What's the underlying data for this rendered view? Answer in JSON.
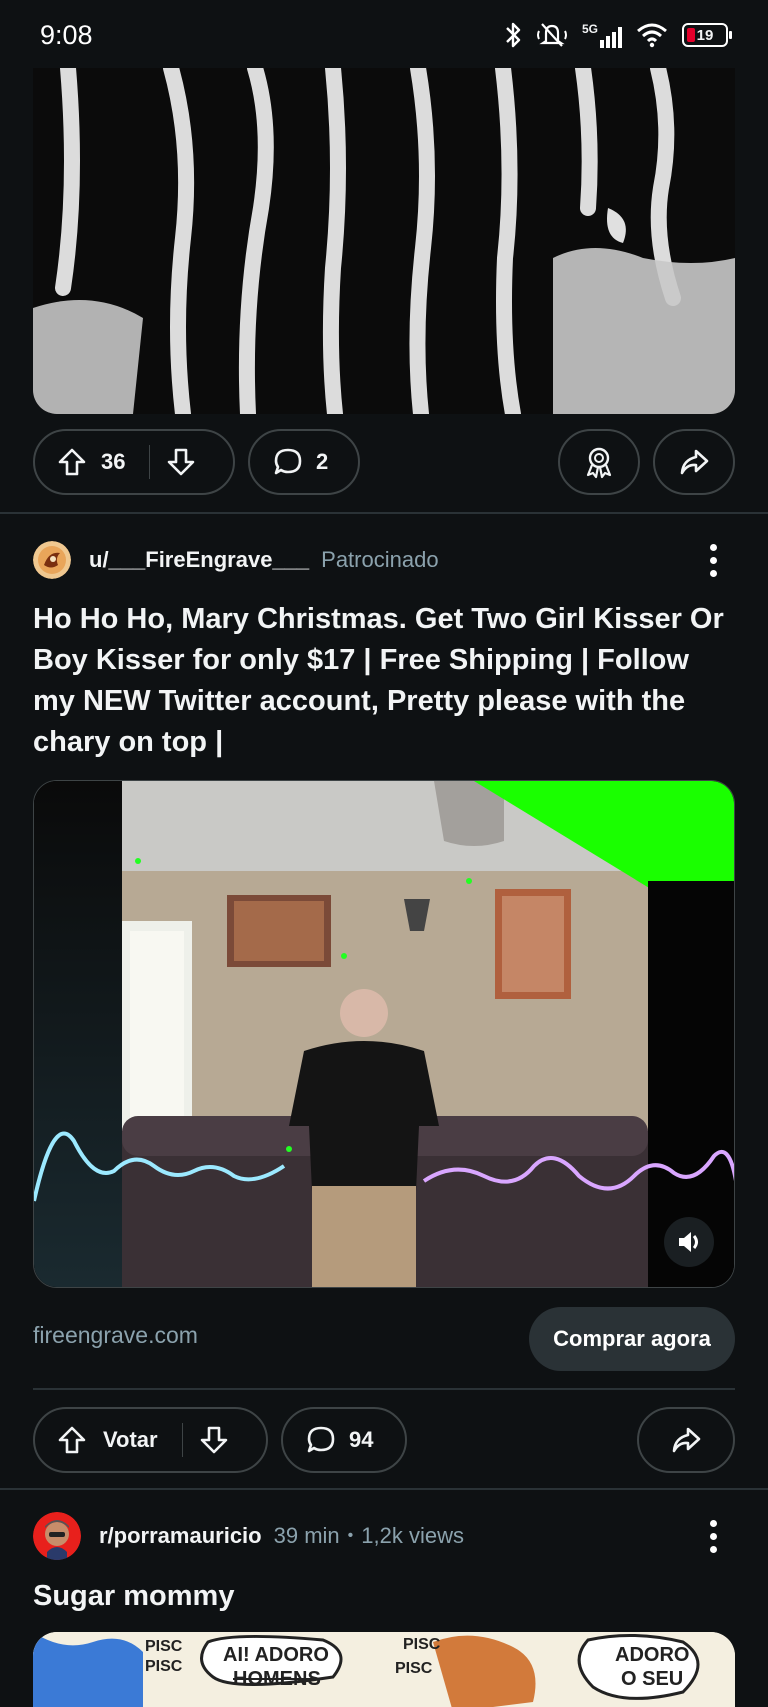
{
  "status_bar": {
    "time": "9:08",
    "network": "5G",
    "battery": "19"
  },
  "post1": {
    "upvotes": "36",
    "comments": "2"
  },
  "ad_post": {
    "username": "u/___FireEngrave___",
    "sponsored_label": "Patrocinado",
    "title": "Ho Ho Ho, Mary Christmas. Get Two Girl Kisser Or Boy Kisser for only $17 | Free Shipping | Follow my NEW Twitter account, Pretty please with the chary on top |",
    "domain": "fireengrave.com",
    "cta_label": "Comprar agora",
    "vote_label": "Votar",
    "comments": "94"
  },
  "post3": {
    "subreddit": "r/porramauricio",
    "time": "39 min",
    "separator": "•",
    "views": "1,2k views",
    "title": "Sugar mommy"
  },
  "comic_text": [
    "PISC",
    "PISC",
    "AI! ADORO",
    "HOMENS",
    "PISC",
    "PISC",
    "ADORO",
    "O SEU"
  ],
  "colors": {
    "background": "#0e1113",
    "muted": "#8ba2ad",
    "pill_border": "#3e4446",
    "green_screen": "#1aff00"
  }
}
